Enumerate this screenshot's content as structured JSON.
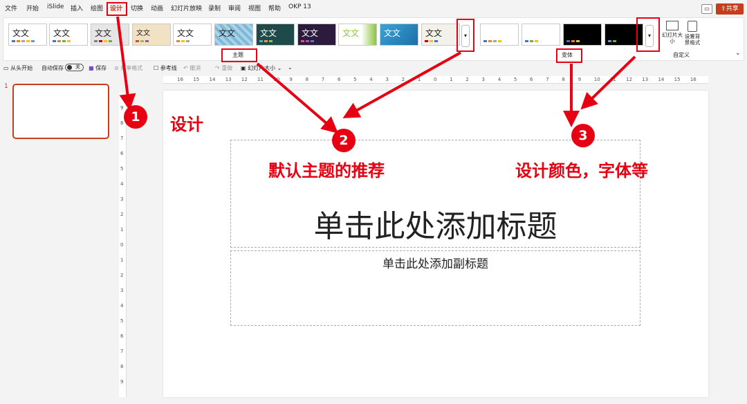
{
  "menu": {
    "items": [
      "文件",
      "开始",
      "iSlide",
      "插入",
      "绘图",
      "设计",
      "切换",
      "动画",
      "幻灯片放映",
      "录制",
      "审阅",
      "视图",
      "帮助",
      "OKP 13"
    ],
    "active": "设计",
    "share_label": "共享"
  },
  "ribbon": {
    "theme_text": "文文",
    "theme_group_label": "主题",
    "variant_group_label": "变体",
    "custom_group_label": "自定义",
    "slide_size_label": "幻灯片大小",
    "bg_format_label": "设置背景格式",
    "colors": {
      "accent": "#c43e1c",
      "annotation_red": "#e60012"
    }
  },
  "quickbar": {
    "from_start": "从头开始",
    "autosave": "自动保存",
    "autosave_state": "关",
    "save": "保存",
    "share_format": "共享格式",
    "guides": "参考线",
    "undo": "撤消",
    "redo": "重做",
    "slide_size": "幻灯片大小"
  },
  "slides_pane": {
    "current_number": "1"
  },
  "ruler": {
    "h_ticks": [
      "16",
      "15",
      "14",
      "13",
      "12",
      "11",
      "10",
      "9",
      "8",
      "7",
      "6",
      "5",
      "4",
      "3",
      "2",
      "1",
      "0",
      "1",
      "2",
      "3",
      "4",
      "5",
      "6",
      "7",
      "8",
      "9",
      "10",
      "11",
      "12",
      "13",
      "14",
      "15",
      "16"
    ],
    "v_ticks": [
      "9",
      "8",
      "7",
      "6",
      "5",
      "4",
      "3",
      "2",
      "1",
      "0",
      "1",
      "2",
      "3",
      "4",
      "5",
      "6",
      "7",
      "8",
      "9"
    ]
  },
  "slide": {
    "title_placeholder": "单击此处添加标题",
    "subtitle_placeholder": "单击此处添加副标题"
  },
  "annotations": {
    "step1_number": "1",
    "step2_number": "2",
    "step3_number": "3",
    "step1_label": "设计",
    "step2_label": "默认主题的推荐",
    "step3_label": "设计颜色，字体等"
  }
}
